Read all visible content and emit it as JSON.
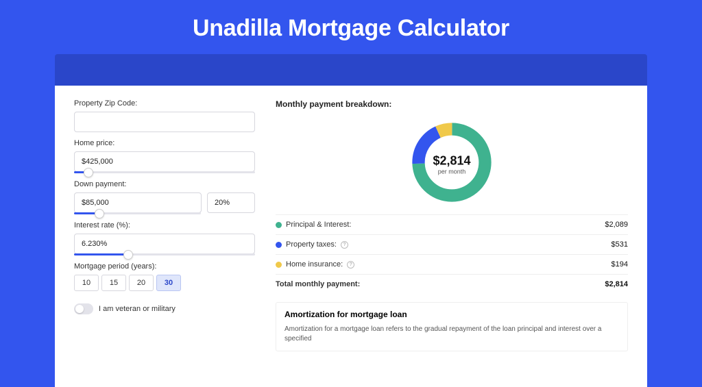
{
  "page_title": "Unadilla Mortgage Calculator",
  "labels": {
    "zip": "Property Zip Code:",
    "home_price": "Home price:",
    "down_payment": "Down payment:",
    "interest_rate": "Interest rate (%):",
    "mortgage_period": "Mortgage period (years):",
    "veteran": "I am veteran or military"
  },
  "inputs": {
    "zip": "",
    "home_price": "$425,000",
    "down_payment_amount": "$85,000",
    "down_payment_pct": "20%",
    "interest_rate": "6.230%"
  },
  "sliders": {
    "home_price_pct": 8,
    "down_payment_pct": 20,
    "interest_rate_pct": 30
  },
  "periods": {
    "options": [
      "10",
      "15",
      "20",
      "30"
    ],
    "selected": "30"
  },
  "breakdown": {
    "title": "Monthly payment breakdown:",
    "donut_amount": "$2,814",
    "donut_sub": "per month",
    "rows": [
      {
        "label": "Principal & Interest:",
        "value": "$2,089",
        "color": "g",
        "info": false
      },
      {
        "label": "Property taxes:",
        "value": "$531",
        "color": "b",
        "info": true
      },
      {
        "label": "Home insurance:",
        "value": "$194",
        "color": "y",
        "info": true
      }
    ],
    "total_label": "Total monthly payment:",
    "total_value": "$2,814"
  },
  "amortization": {
    "title": "Amortization for mortgage loan",
    "text": "Amortization for a mortgage loan refers to the gradual repayment of the loan principal and interest over a specified"
  },
  "chart_data": {
    "type": "pie",
    "title": "Monthly payment breakdown",
    "series": [
      {
        "name": "Principal & Interest",
        "value": 2089,
        "color": "#3fb28f"
      },
      {
        "name": "Property taxes",
        "value": 531,
        "color": "#3355ee"
      },
      {
        "name": "Home insurance",
        "value": 194,
        "color": "#f0c94a"
      }
    ],
    "total": 2814,
    "unit": "USD per month"
  }
}
